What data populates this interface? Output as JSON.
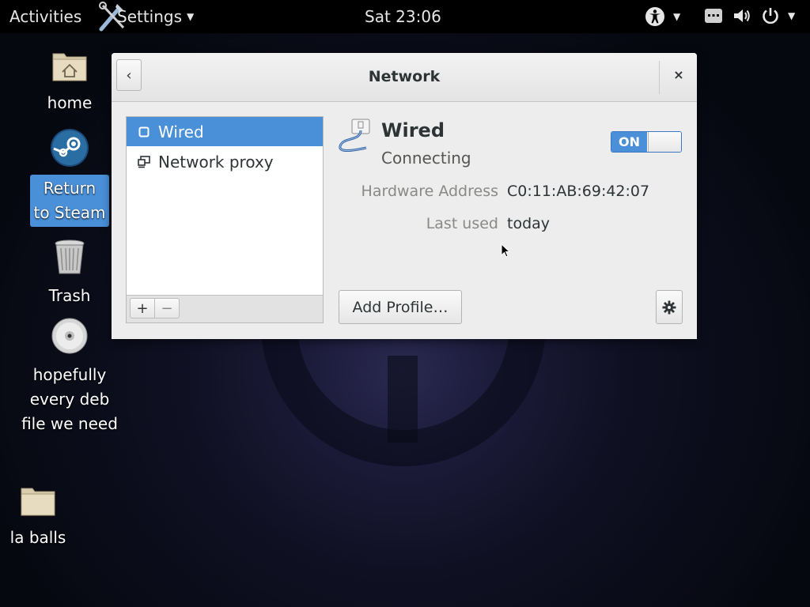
{
  "topbar": {
    "activities": "Activities",
    "app_menu": "Settings",
    "clock": "Sat 23:06"
  },
  "desktop": {
    "icons": [
      {
        "label": "home",
        "icon": "home-folder-icon"
      },
      {
        "label": "Return to Steam",
        "icon": "steam-icon",
        "selected": true
      },
      {
        "label": "Trash",
        "icon": "trash-icon"
      },
      {
        "label": "hopefully every deb file we need",
        "icon": "disc-icon"
      },
      {
        "label": "la balls",
        "icon": "folder-icon"
      }
    ]
  },
  "window": {
    "title": "Network",
    "devices": [
      {
        "label": "Wired",
        "icon": "wired-icon",
        "selected": true
      },
      {
        "label": "Network proxy",
        "icon": "proxy-icon"
      }
    ],
    "toolbar": {
      "add": "+",
      "remove": "−"
    },
    "detail": {
      "name": "Wired",
      "status": "Connecting",
      "switch_label": "ON",
      "switch_on": true,
      "hardware_address_label": "Hardware Address",
      "hardware_address": "C0:11:AB:69:42:07",
      "last_used_label": "Last used",
      "last_used": "today",
      "add_profile": "Add Profile…"
    }
  },
  "colors": {
    "accent": "#4a90d9",
    "topbar": "#000000",
    "window_bg": "#ededed"
  }
}
